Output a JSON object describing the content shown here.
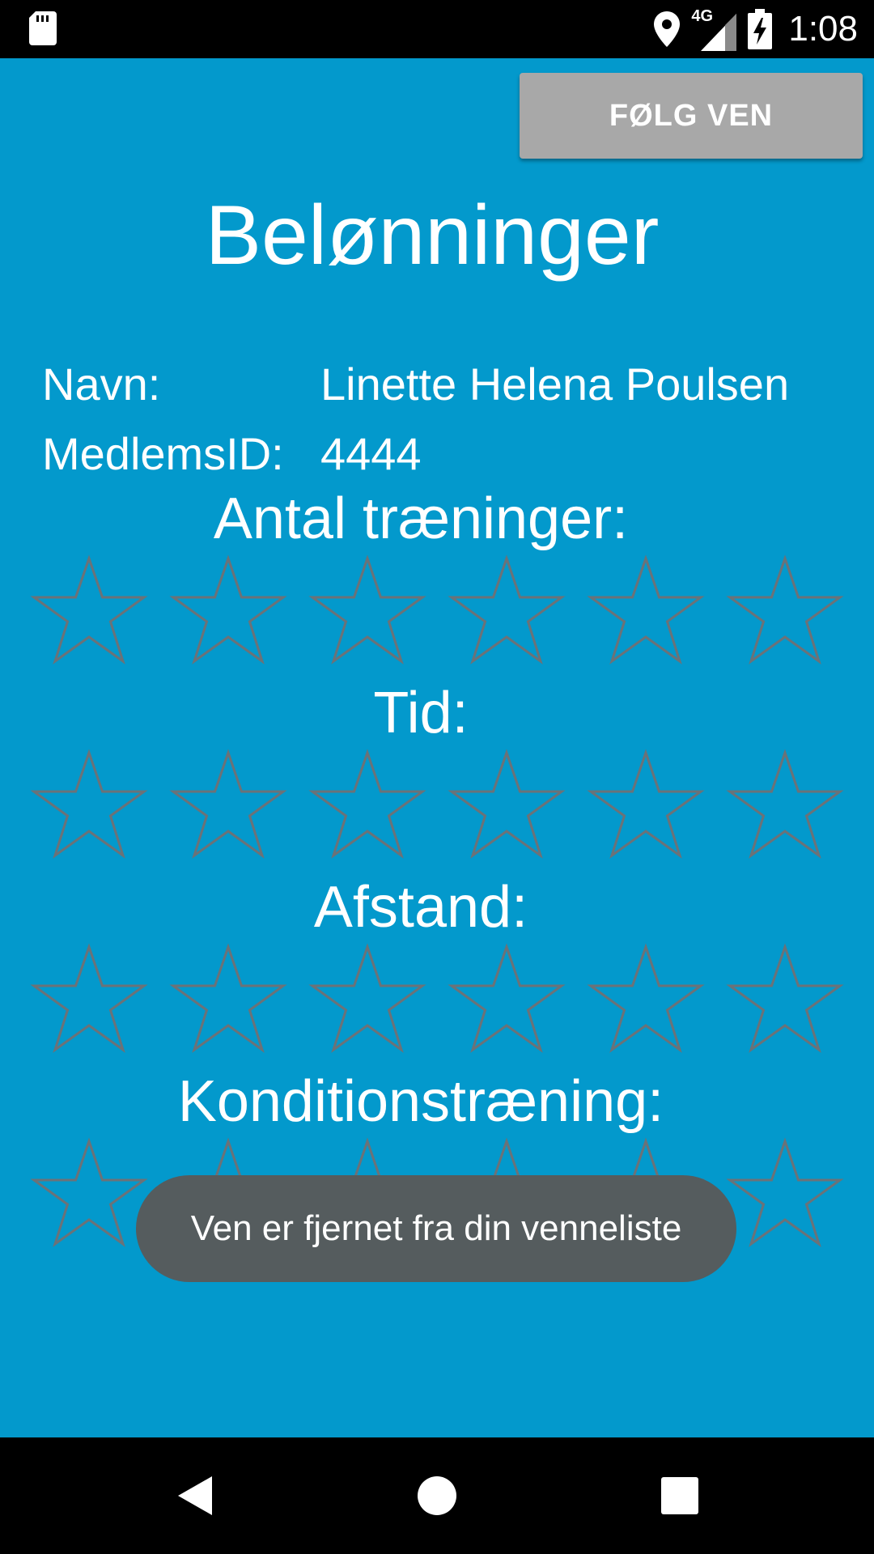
{
  "status_bar": {
    "time": "1:08",
    "network": "4G",
    "icons": [
      "sd-card-icon",
      "location-icon",
      "signal-icon",
      "battery-charging-icon"
    ]
  },
  "header": {
    "follow_button_label": "FØLG VEN"
  },
  "title": "Belønninger",
  "profile": {
    "name_label": "Navn:",
    "name_value": "Linette Helena Poulsen",
    "id_label": "MedlemsID:",
    "id_value": "4444"
  },
  "sections": [
    {
      "label": "Antal træninger:",
      "stars_total": 6,
      "stars_filled": 0
    },
    {
      "label": "Tid:",
      "stars_total": 6,
      "stars_filled": 0
    },
    {
      "label": "Afstand:",
      "stars_total": 6,
      "stars_filled": 0
    },
    {
      "label": "Konditionstræning:",
      "stars_total": 6,
      "stars_filled": 0
    }
  ],
  "toast": {
    "message": "Ven er fjernet fra din venneliste"
  },
  "nav": {
    "icons": [
      "back-icon",
      "home-icon",
      "recents-icon"
    ]
  },
  "colors": {
    "background": "#0399CC",
    "button": "#A8A8A8",
    "star_outline": "#6B7278",
    "toast": "#555C5E"
  }
}
